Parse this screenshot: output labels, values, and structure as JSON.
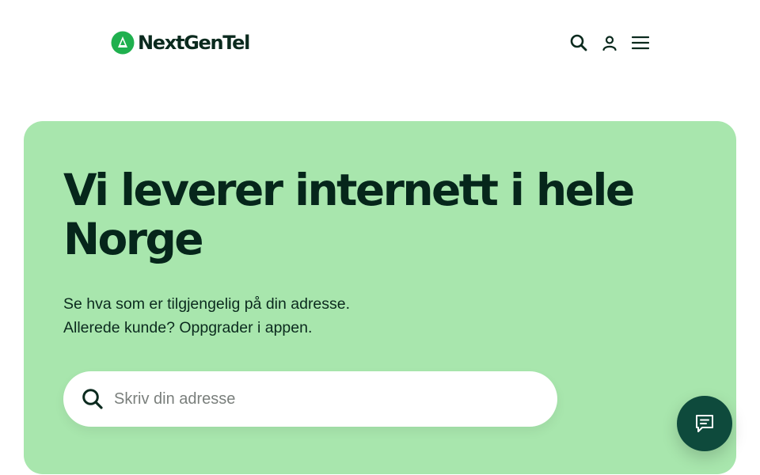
{
  "header": {
    "logo_text": "NextGenTel",
    "icons": [
      "search-icon",
      "user-icon",
      "menu-icon"
    ]
  },
  "hero": {
    "title": "Vi leverer internett i hele Norge",
    "subtitle_lines": [
      "Se hva som er tilgjengelig på din adresse.",
      "Allerede kunde? Oppgrader i appen."
    ],
    "search": {
      "placeholder": "Skriv din adresse",
      "value": ""
    }
  },
  "chat": {
    "icon": "chat-icon"
  },
  "colors": {
    "brand_green": "#1fb04e",
    "hero_background": "#a8e6ad",
    "text_dark": "#06261b",
    "chat_button": "#0e4a3c"
  }
}
